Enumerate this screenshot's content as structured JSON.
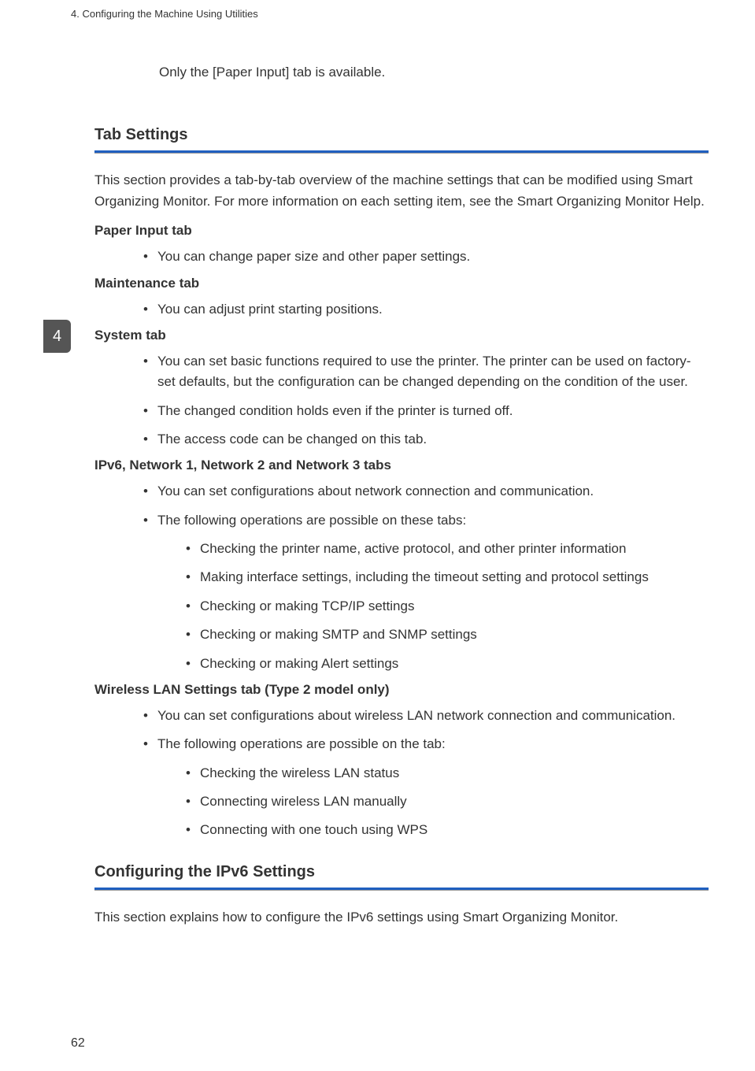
{
  "header": {
    "chapter_title": "4. Configuring the Machine Using Utilities"
  },
  "chapter_tab": "4",
  "page_number": "62",
  "intro": "Only the [Paper Input] tab is available.",
  "section1": {
    "heading": "Tab Settings",
    "text": "This section provides a tab-by-tab overview of the machine settings that can be modified using Smart Organizing Monitor. For more information on each setting item, see the Smart Organizing Monitor Help.",
    "tabs": {
      "paper_input": {
        "title": "Paper Input tab",
        "items": [
          "You can change paper size and other paper settings."
        ]
      },
      "maintenance": {
        "title": "Maintenance tab",
        "items": [
          "You can adjust print starting positions."
        ]
      },
      "system": {
        "title": "System tab",
        "items": [
          "You can set basic functions required to use the printer. The printer can be used on factory-set defaults, but the configuration can be changed depending on the condition of the user.",
          "The changed condition holds even if the printer is turned off.",
          "The access code can be changed on this tab."
        ]
      },
      "network": {
        "title": "IPv6, Network 1, Network 2 and Network 3 tabs",
        "items": [
          "You can set configurations about network connection and communication.",
          "The following operations are possible on these tabs:"
        ],
        "subitems": [
          "Checking the printer name, active protocol, and other printer information",
          "Making interface settings, including the timeout setting and protocol settings",
          "Checking or making TCP/IP settings",
          "Checking or making SMTP and SNMP settings",
          "Checking or making Alert settings"
        ]
      },
      "wireless": {
        "title": "Wireless LAN Settings tab (Type 2 model only)",
        "items": [
          "You can set configurations about wireless LAN network connection and communication.",
          "The following operations are possible on the tab:"
        ],
        "subitems": [
          "Checking the wireless LAN status",
          "Connecting wireless LAN manually",
          "Connecting with one touch using WPS"
        ]
      }
    }
  },
  "section2": {
    "heading": "Configuring the IPv6 Settings",
    "text": "This section explains how to configure the IPv6 settings using Smart Organizing Monitor."
  }
}
